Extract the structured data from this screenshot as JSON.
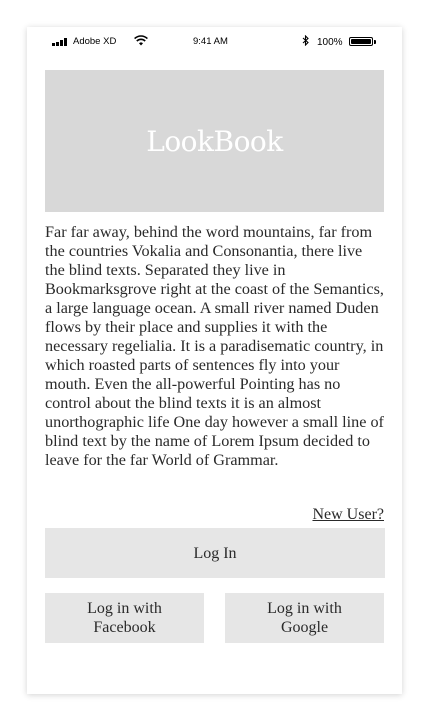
{
  "status_bar": {
    "carrier": "Adobe XD",
    "time": "9:41 AM",
    "battery": "100%",
    "battery_level": 1.0,
    "icons": [
      "signal-icon",
      "wifi-icon",
      "bluetooth-icon",
      "battery-icon"
    ]
  },
  "hero": {
    "title": "LookBook",
    "background_color": "#d8d8d8"
  },
  "body_text": "Far far away, behind the word mountains, far from the countries Vokalia and Consonantia, there live the blind texts. Separated they live in Bookmarksgrove right at the coast of the Semantics, a large language ocean. A small river named Duden flows by their place and supplies it with the necessary regelialia. It is a paradisematic country, in which roasted parts of sentences fly into your mouth. Even the all-powerful Pointing has no control about the blind texts it is an almost unorthographic life One day however a small line of blind text by the name of Lorem Ipsum decided to leave for the far World of Grammar.",
  "auth": {
    "new_user_link": "New User?",
    "login_button": "Log In",
    "facebook_button": "Log in with\nFacebook",
    "google_button": "Log in with\nGoogle",
    "button_color": "#e6e6e6"
  }
}
